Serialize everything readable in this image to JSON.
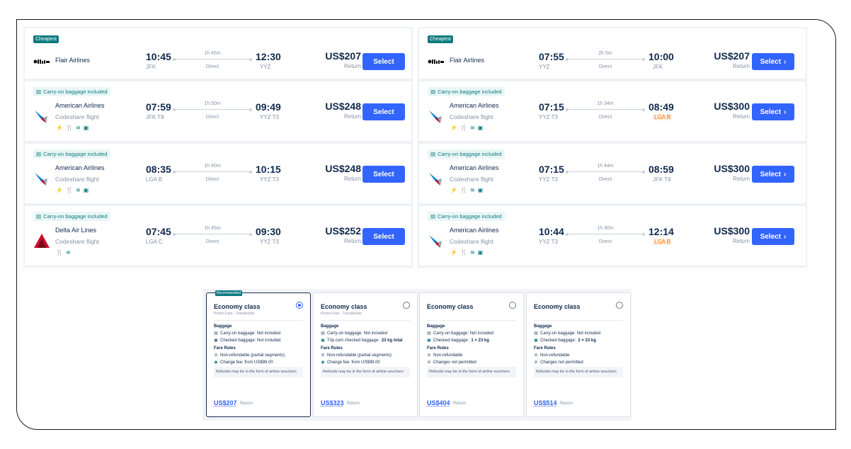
{
  "left": {
    "flights": [
      {
        "tag": "Cheapest",
        "airline": "Flair Airlines",
        "codeshare": "",
        "amenities": [],
        "dep_time": "10:45",
        "dep_apt": "JFK",
        "duration": "1h 45m",
        "stops": "Direct",
        "arr_time": "12:30",
        "arr_apt": "YYZ",
        "arr_warn": false,
        "price": "US$207",
        "trip": "Return",
        "button": "Select"
      },
      {
        "tag": "Carry-on baggage included",
        "airline": "American Airlines",
        "codeshare": "Codeshare flight",
        "amenities": [
          "power-icon",
          "meal-icon",
          "wifi-icon",
          "entertainment-icon"
        ],
        "dep_time": "07:59",
        "dep_apt": "JFK T8",
        "duration": "1h 50m",
        "stops": "Direct",
        "arr_time": "09:49",
        "arr_apt": "YYZ T3",
        "arr_warn": false,
        "price": "US$248",
        "trip": "Return",
        "button": "Select"
      },
      {
        "tag": "Carry-on baggage included",
        "airline": "American Airlines",
        "codeshare": "Codeshare flight",
        "amenities": [
          "power-icon",
          "meal-icon",
          "wifi-icon",
          "entertainment-icon"
        ],
        "dep_time": "08:35",
        "dep_apt": "LGA B",
        "duration": "1h 40m",
        "stops": "Direct",
        "arr_time": "10:15",
        "arr_apt": "YYZ T3",
        "arr_warn": false,
        "price": "US$248",
        "trip": "Return",
        "button": "Select"
      },
      {
        "tag": "Carry-on baggage included",
        "airline": "Delta Air Lines",
        "codeshare": "Codeshare flight",
        "amenities": [
          "meal-icon",
          "wifi-icon"
        ],
        "dep_time": "07:45",
        "dep_apt": "LGA C",
        "duration": "1h 45m",
        "stops": "Direct",
        "arr_time": "09:30",
        "arr_apt": "YYZ T3",
        "arr_warn": false,
        "price": "US$252",
        "trip": "Return",
        "button": "Select"
      }
    ]
  },
  "right": {
    "flights": [
      {
        "tag": "Cheapest",
        "airline": "Flair Airlines",
        "codeshare": "",
        "amenities": [],
        "dep_time": "07:55",
        "dep_apt": "YYZ",
        "duration": "2h 5m",
        "stops": "Direct",
        "arr_time": "10:00",
        "arr_apt": "JFK",
        "arr_warn": false,
        "price": "US$207",
        "trip": "Return",
        "button": "Select"
      },
      {
        "tag": "Carry-on baggage included",
        "airline": "American Airlines",
        "codeshare": "Codeshare flight",
        "amenities": [
          "power-icon",
          "meal-icon",
          "wifi-icon",
          "entertainment-icon"
        ],
        "dep_time": "07:15",
        "dep_apt": "YYZ T3",
        "duration": "1h 34m",
        "stops": "Direct",
        "arr_time": "08:49",
        "arr_apt": "LGA B",
        "arr_warn": true,
        "price": "US$300",
        "trip": "Return",
        "button": "Select"
      },
      {
        "tag": "Carry-on baggage included",
        "airline": "American Airlines",
        "codeshare": "Codeshare flight",
        "amenities": [
          "power-icon",
          "meal-icon",
          "wifi-icon",
          "entertainment-icon"
        ],
        "dep_time": "07:15",
        "dep_apt": "YYZ T3",
        "duration": "1h 44m",
        "stops": "Direct",
        "arr_time": "08:59",
        "arr_apt": "JFK T8",
        "arr_warn": false,
        "price": "US$300",
        "trip": "Return",
        "button": "Select"
      },
      {
        "tag": "Carry-on baggage included",
        "airline": "American Airlines",
        "codeshare": "Codeshare flight",
        "amenities": [
          "power-icon",
          "meal-icon",
          "wifi-icon",
          "entertainment-icon"
        ],
        "dep_time": "10:44",
        "dep_apt": "YYZ T3",
        "duration": "1h 30m",
        "stops": "Direct",
        "arr_time": "12:14",
        "arr_apt": "LGA B",
        "arr_warn": true,
        "price": "US$300",
        "trip": "Return",
        "button": "Select"
      }
    ]
  },
  "fares": [
    {
      "recommended": "Recommended",
      "title": "Economy class",
      "subtitle": "Promo Fare - Transborder",
      "selected": true,
      "baggage_h": "Baggage",
      "bag1": "Carry-on baggage: Not included",
      "bag2": "Checked baggage: Not included",
      "bag2_bold": "",
      "rules_h": "Fare Rules",
      "rule1": "Non-refundable (partial segments)",
      "rule2": "Change fee: from US$99.00",
      "note": "Refunds may be in the form of airline vouchers",
      "price": "US$207",
      "trip": "Return"
    },
    {
      "recommended": "",
      "title": "Economy class",
      "subtitle": "Promo Fare - Transborder",
      "selected": false,
      "baggage_h": "Baggage",
      "bag1": "Carry-on baggage: Not included",
      "bag2": "Trip.com checked baggage:",
      "bag2_bold": "23 kg total",
      "rules_h": "Fare Rules",
      "rule1": "Non-refundable (partial segments)",
      "rule2": "Change fee: from US$99.00",
      "note": "Refunds may be in the form of airline vouchers",
      "price": "US$323",
      "trip": "Return"
    },
    {
      "recommended": "",
      "title": "Economy class",
      "subtitle": "",
      "selected": false,
      "baggage_h": "Baggage",
      "bag1": "Carry-on baggage: Not included",
      "bag2": "Checked baggage:",
      "bag2_bold": "1 × 23 kg",
      "rules_h": "Fare Rules",
      "rule1": "Non-refundable",
      "rule2": "Changes not permitted",
      "note": "Refunds may be in the form of airline vouchers",
      "price": "US$404",
      "trip": "Return"
    },
    {
      "recommended": "",
      "title": "Economy class",
      "subtitle": "",
      "selected": false,
      "baggage_h": "Baggage",
      "bag1": "Carry-on baggage: Not included",
      "bag2": "Checked baggage:",
      "bag2_bold": "2 × 23 kg",
      "rules_h": "Fare Rules",
      "rule1": "Non-refundable",
      "rule2": "Changes not permitted",
      "note": "Refunds may be in the form of airline vouchers",
      "price": "US$514",
      "trip": "Return"
    }
  ],
  "colors": {
    "accent": "#3264ff",
    "teal": "#0d7b80",
    "warn": "#ff6f00",
    "text": "#0f294d"
  }
}
